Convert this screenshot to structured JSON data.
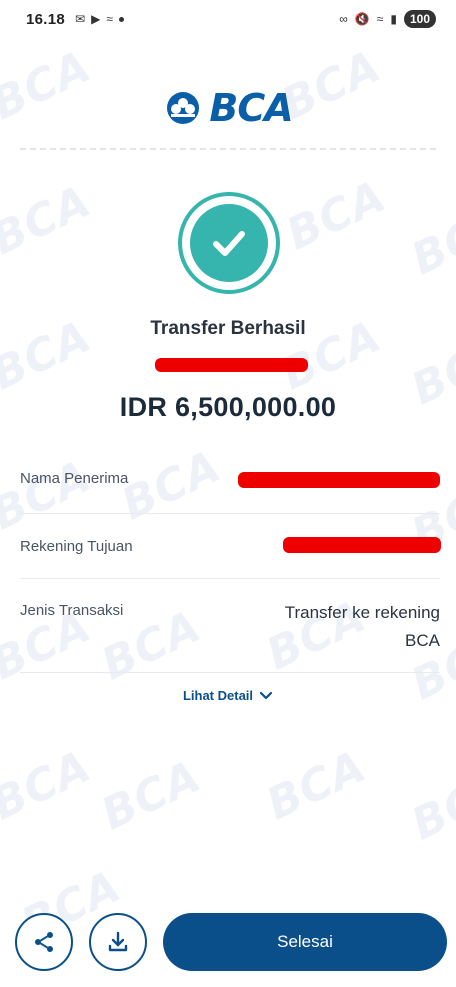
{
  "status_bar": {
    "time": "16.18",
    "icons": [
      "gmail-icon",
      "youtube-icon",
      "wave-icon"
    ],
    "battery": "100"
  },
  "brand": {
    "logo_text": "BCA",
    "watermark": "BCA"
  },
  "result": {
    "title": "Transfer Berhasil",
    "amount": "IDR 6,500,000.00"
  },
  "details": [
    {
      "label": "Nama Penerima",
      "value": ""
    },
    {
      "label": "Rekening Tujuan",
      "value": ""
    },
    {
      "label": "Jenis Transaksi",
      "value_line1": "Transfer ke rekening",
      "value_line2": "BCA"
    }
  ],
  "detail_link": "Lihat Detail",
  "actions": {
    "share_icon": "share-icon",
    "download_icon": "download-icon",
    "done_label": "Selesai"
  },
  "colors": {
    "brand_blue": "#0b4f8a",
    "success_teal": "#35b5ad",
    "redaction": "#ee0000"
  }
}
